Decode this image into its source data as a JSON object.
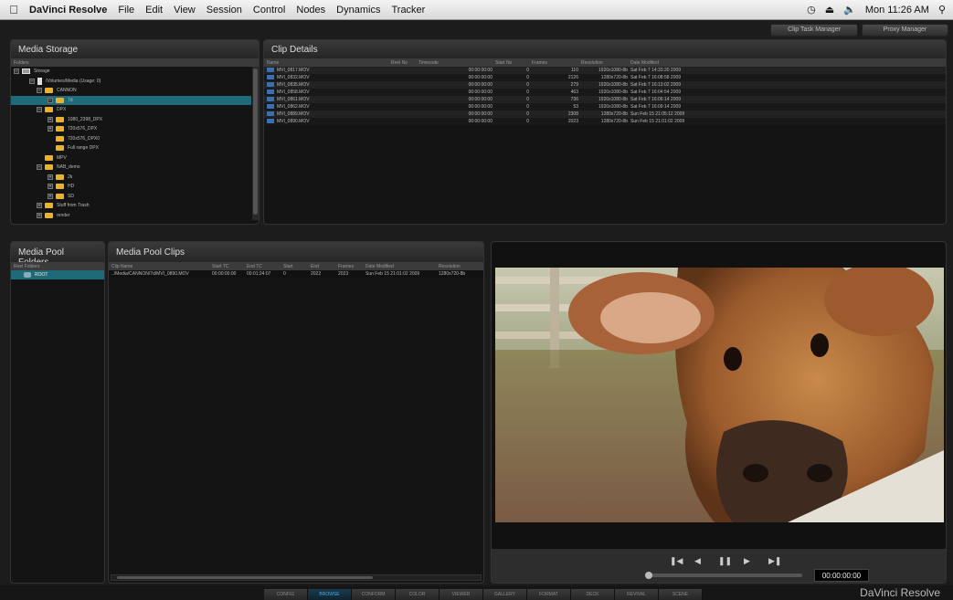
{
  "menubar": {
    "app_name": "DaVinci Resolve",
    "menus": [
      "File",
      "Edit",
      "View",
      "Session",
      "Control",
      "Nodes",
      "Dynamics",
      "Tracker"
    ],
    "clock": "Mon 11:26 AM"
  },
  "managers": {
    "clip_task": "Clip Task Manager",
    "proxy": "Proxy Manager"
  },
  "media_storage": {
    "title": "Media Storage",
    "header": "Folders",
    "tree": [
      {
        "label": "Storage"
      },
      {
        "label": "/Volumes/Media (Usage: 0)"
      },
      {
        "label": "CANNON"
      },
      {
        "label": "7d"
      },
      {
        "label": "DPX"
      },
      {
        "label": "1080_2398_DPX"
      },
      {
        "label": "720x576_DPX"
      },
      {
        "label": "720x576_DPX0"
      },
      {
        "label": "Full range DPX"
      },
      {
        "label": "MPV"
      },
      {
        "label": "NAB_demo"
      },
      {
        "label": "2k"
      },
      {
        "label": "HD"
      },
      {
        "label": "SD"
      },
      {
        "label": "Stuff from Trash"
      },
      {
        "label": "render"
      }
    ]
  },
  "clip_details": {
    "title": "Clip Details",
    "columns": [
      "Name",
      "Reel No",
      "Timecode",
      "Start No",
      "Frames",
      "Resolution",
      "Date Modified"
    ],
    "rows": [
      [
        "MVI_0817.MOV",
        "",
        "00:00:00:00",
        "0",
        "110",
        "1920x1080-8b",
        "Sat Feb  7 14:33:20 2009"
      ],
      [
        "MVI_0832.MOV",
        "",
        "00:00:00:00",
        "0",
        "2126",
        "1280x720-8b",
        "Sat Feb  7 16:08:58 2009"
      ],
      [
        "MVI_0835.MOV",
        "",
        "00:00:00:00",
        "0",
        "279",
        "1920x1080-8b",
        "Sat Feb  7 16:13:02 2009"
      ],
      [
        "MVI_0858.MOV",
        "",
        "00:00:00:00",
        "0",
        "463",
        "1920x1080-8b",
        "Sat Feb  7 16:04:54 2009"
      ],
      [
        "MVI_0861.MOV",
        "",
        "00:00:00:00",
        "0",
        "736",
        "1920x1080-8b",
        "Sat Feb  7 16:06:14 2009"
      ],
      [
        "MVI_0862.MOV",
        "",
        "00:00:00:00",
        "0",
        "53",
        "1920x1080-8b",
        "Sat Feb  7 16:09:14 2009"
      ],
      [
        "MVI_0889.MOV",
        "",
        "00:00:00:00",
        "0",
        "2308",
        "1280x720-8b",
        "Sun Feb 15 21:05:12 2009"
      ],
      [
        "MVI_0890.MOV",
        "",
        "00:00:00:00",
        "0",
        "2023",
        "1280x720-8b",
        "Sun Feb 15 21:01:02 2009"
      ]
    ]
  },
  "pool_folders": {
    "title": "Media Pool Folders",
    "header": "Reel Folders",
    "root": "ROOT"
  },
  "pool_clips": {
    "title": "Media Pool Clips",
    "columns": [
      "Clip Name",
      "Start TC",
      "End TC",
      "Start",
      "End",
      "Frames",
      "Date Modified",
      "Resolution"
    ],
    "rows": [
      [
        "../Media/CANNON/7d/MVI_0890.MOV",
        "00:00:00:00",
        "00:01:24:07",
        "0",
        "2022",
        "2023",
        "Sun Feb 15 21:01:02 2009",
        "1280x720-8b"
      ]
    ]
  },
  "viewer": {
    "timecode": "00:00:00:00",
    "playhead": 0.0
  },
  "tabs": [
    {
      "label": "CONFIG",
      "active": false
    },
    {
      "label": "BROWSE",
      "active": true
    },
    {
      "label": "CONFORM",
      "active": false
    },
    {
      "label": "COLOR",
      "active": false
    },
    {
      "label": "VIEWER",
      "active": false
    },
    {
      "label": "GALLERY",
      "active": false
    },
    {
      "label": "FORMAT",
      "active": false
    },
    {
      "label": "DECK",
      "active": false
    },
    {
      "label": "REVIVAL",
      "active": false
    },
    {
      "label": "SCENE",
      "active": false
    }
  ],
  "brand": "DaVinci Resolve"
}
